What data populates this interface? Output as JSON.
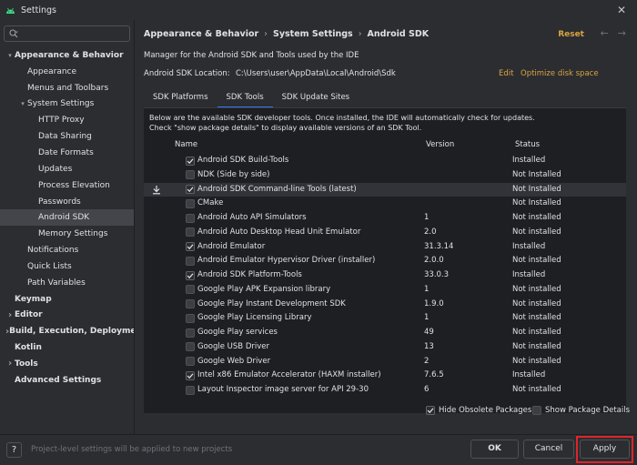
{
  "window": {
    "title": "Settings",
    "close_glyph": "✕",
    "brand_color": "#3ddc84"
  },
  "sidebar": {
    "search_placeholder": "",
    "items": [
      {
        "label": "Appearance & Behavior",
        "level": 0,
        "bold": true,
        "arrow": "down"
      },
      {
        "label": "Appearance",
        "level": 1
      },
      {
        "label": "Menus and Toolbars",
        "level": 1
      },
      {
        "label": "System Settings",
        "level": 1,
        "arrow": "down"
      },
      {
        "label": "HTTP Proxy",
        "level": 2
      },
      {
        "label": "Data Sharing",
        "level": 2
      },
      {
        "label": "Date Formats",
        "level": 2
      },
      {
        "label": "Updates",
        "level": 2
      },
      {
        "label": "Process Elevation",
        "level": 2
      },
      {
        "label": "Passwords",
        "level": 2
      },
      {
        "label": "Android SDK",
        "level": 2,
        "selected": true
      },
      {
        "label": "Memory Settings",
        "level": 2
      },
      {
        "label": "Notifications",
        "level": 1
      },
      {
        "label": "Quick Lists",
        "level": 1
      },
      {
        "label": "Path Variables",
        "level": 1
      },
      {
        "label": "Keymap",
        "level": 0,
        "bold": true
      },
      {
        "label": "Editor",
        "level": 0,
        "bold": true,
        "arrow": "right"
      },
      {
        "label": "Build, Execution, Deployment",
        "level": 0,
        "bold": true,
        "arrow": "right"
      },
      {
        "label": "Kotlin",
        "level": 0,
        "bold": true
      },
      {
        "label": "Tools",
        "level": 0,
        "bold": true,
        "arrow": "right"
      },
      {
        "label": "Advanced Settings",
        "level": 0,
        "bold": true
      }
    ]
  },
  "header": {
    "breadcrumb": [
      "Appearance & Behavior",
      "System Settings",
      "Android SDK"
    ],
    "breadcrumb_sep": "›",
    "reset_label": "Reset",
    "back_glyph": "←",
    "forward_glyph": "→"
  },
  "sdk": {
    "description": "Manager for the Android SDK and Tools used by the IDE",
    "location_label": "Android SDK Location:",
    "location_value": "C:\\Users\\user\\AppData\\Local\\Android\\Sdk",
    "edit_label": "Edit",
    "optimize_label": "Optimize disk space",
    "accent_color": "#d9a343"
  },
  "tabs": [
    {
      "label": "SDK Platforms",
      "active": false
    },
    {
      "label": "SDK Tools",
      "active": true
    },
    {
      "label": "SDK Update Sites",
      "active": false
    }
  ],
  "panel": {
    "info_line1": "Below are the available SDK developer tools. Once installed, the IDE will automatically check for updates.",
    "info_line2": "Check \"show package details\" to display available versions of an SDK Tool.",
    "columns": {
      "name": "Name",
      "version": "Version",
      "status": "Status"
    },
    "rows": [
      {
        "name": "Android SDK Build-Tools",
        "version": "",
        "status": "Installed",
        "checked": true
      },
      {
        "name": "NDK (Side by side)",
        "version": "",
        "status": "Not Installed",
        "checked": false
      },
      {
        "name": "Android SDK Command-line Tools (latest)",
        "version": "",
        "status": "Not Installed",
        "checked": true,
        "download": true
      },
      {
        "name": "CMake",
        "version": "",
        "status": "Not Installed",
        "checked": false
      },
      {
        "name": "Android Auto API Simulators",
        "version": "1",
        "status": "Not installed",
        "checked": false
      },
      {
        "name": "Android Auto Desktop Head Unit Emulator",
        "version": "2.0",
        "status": "Not installed",
        "checked": false
      },
      {
        "name": "Android Emulator",
        "version": "31.3.14",
        "status": "Installed",
        "checked": true
      },
      {
        "name": "Android Emulator Hypervisor Driver (installer)",
        "version": "2.0.0",
        "status": "Not installed",
        "checked": false
      },
      {
        "name": "Android SDK Platform-Tools",
        "version": "33.0.3",
        "status": "Installed",
        "checked": true
      },
      {
        "name": "Google Play APK Expansion library",
        "version": "1",
        "status": "Not installed",
        "checked": false
      },
      {
        "name": "Google Play Instant Development SDK",
        "version": "1.9.0",
        "status": "Not installed",
        "checked": false
      },
      {
        "name": "Google Play Licensing Library",
        "version": "1",
        "status": "Not installed",
        "checked": false
      },
      {
        "name": "Google Play services",
        "version": "49",
        "status": "Not installed",
        "checked": false
      },
      {
        "name": "Google USB Driver",
        "version": "13",
        "status": "Not installed",
        "checked": false
      },
      {
        "name": "Google Web Driver",
        "version": "2",
        "status": "Not installed",
        "checked": false
      },
      {
        "name": "Intel x86 Emulator Accelerator (HAXM installer)",
        "version": "7.6.5",
        "status": "Installed",
        "checked": true
      },
      {
        "name": "Layout Inspector image server for API 29-30",
        "version": "6",
        "status": "Not installed",
        "checked": false
      }
    ]
  },
  "options": {
    "hide_obsolete_label": "Hide Obsolete Packages",
    "hide_obsolete_checked": true,
    "show_details_label": "Show Package Details",
    "show_details_checked": false
  },
  "footer": {
    "help_label": "?",
    "note": "Project-level settings will be applied to new projects",
    "ok_label": "OK",
    "cancel_label": "Cancel",
    "apply_label": "Apply",
    "highlight_color": "#e0242b"
  }
}
